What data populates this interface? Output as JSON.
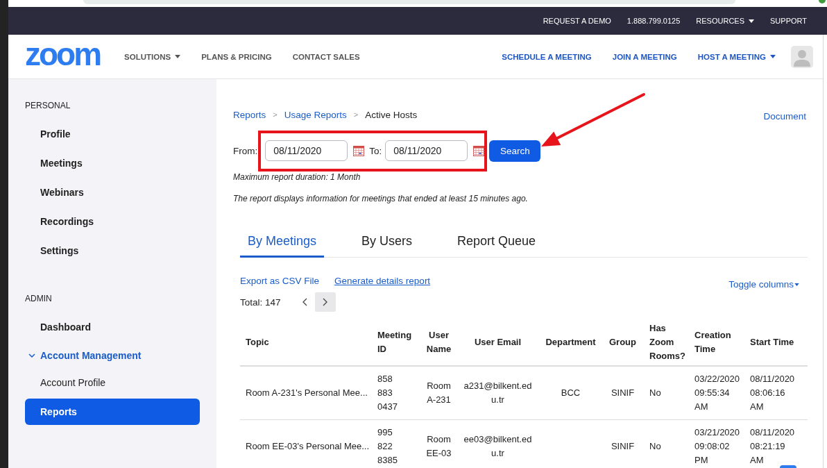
{
  "top_bar": {
    "links": [
      {
        "label": "REQUEST A DEMO",
        "dropdown": false
      },
      {
        "label": "1.888.799.0125",
        "dropdown": false
      },
      {
        "label": "RESOURCES",
        "dropdown": true
      },
      {
        "label": "SUPPORT",
        "dropdown": false
      }
    ]
  },
  "nav": {
    "logo": "zoom",
    "left_links": [
      {
        "label": "SOLUTIONS",
        "dropdown": true
      },
      {
        "label": "PLANS & PRICING",
        "dropdown": false
      },
      {
        "label": "CONTACT SALES",
        "dropdown": false
      }
    ],
    "right_links": [
      {
        "label": "SCHEDULE A MEETING",
        "dropdown": false
      },
      {
        "label": "JOIN A MEETING",
        "dropdown": false
      },
      {
        "label": "HOST A MEETING",
        "dropdown": true
      }
    ]
  },
  "sidebar": {
    "sections": [
      {
        "title": "PERSONAL",
        "items": [
          {
            "label": "Profile",
            "selected": false
          },
          {
            "label": "Meetings",
            "selected": false
          },
          {
            "label": "Webinars",
            "selected": false
          },
          {
            "label": "Recordings",
            "selected": false
          },
          {
            "label": "Settings",
            "selected": false
          }
        ]
      },
      {
        "title": "ADMIN",
        "items": [
          {
            "label": "Dashboard",
            "selected": false
          },
          {
            "label": "Account Management",
            "selected": false,
            "expanded": true,
            "children": [
              {
                "label": "Account Profile",
                "selected": false
              },
              {
                "label": "Reports",
                "selected": true
              }
            ]
          }
        ]
      }
    ]
  },
  "breadcrumb": [
    {
      "kind": "link",
      "text": "Reports"
    },
    {
      "kind": "separator",
      "text": ">"
    },
    {
      "kind": "link",
      "text": "Usage Reports"
    },
    {
      "kind": "separator",
      "text": ">"
    },
    {
      "kind": "current",
      "text": "Active Hosts"
    }
  ],
  "document_link": "Document",
  "date_filter": {
    "from_label": "From:",
    "from_value": "08/11/2020",
    "to_label": "To:",
    "to_value": "08/11/2020",
    "search_button": "Search"
  },
  "annotations": {
    "frame": true,
    "arrow": true
  },
  "notes": [
    "Maximum report duration: 1 Month",
    "The report displays information for meetings that ended at least 15 minutes ago."
  ],
  "tabs": [
    {
      "label": "By Meetings",
      "selected": true
    },
    {
      "label": "By Users",
      "selected": false
    },
    {
      "label": "Report Queue",
      "selected": false
    }
  ],
  "actions": {
    "export_link": "Export as CSV File",
    "details_link": "Generate details report",
    "toggle_columns": "Toggle columns"
  },
  "total": "Total: 147",
  "pagination": {
    "prev": {
      "hovered": false
    },
    "next": {
      "hovered": true
    }
  },
  "table": {
    "columns": [
      "Topic",
      "Meeting ID",
      "User Name",
      "User Email",
      "Department",
      "Group",
      "Has Zoom Rooms?",
      "Creation Time",
      "Start Time"
    ],
    "rows": [
      {
        "topic": "Room A-231's Personal Mee...",
        "meeting_id": "858 883 0437",
        "user_name": "Room A-231",
        "user_email": "a231@bilkent.edu.tr",
        "department": "BCC",
        "group": "SINIF",
        "has_zoom_rooms": "No",
        "creation_time": "03/22/2020 09:55:34 AM",
        "start_time": "08/11/2020 08:06:16 AM"
      },
      {
        "topic": "Room EE-03's Personal Mee...",
        "meeting_id": "995 822 8385",
        "user_name": "Room EE-03",
        "user_email": "ee03@bilkent.edu.tr",
        "group": "SINIF",
        "has_zoom_rooms": "No",
        "creation_time": "03/21/2020 09:08:02 PM",
        "start_time": "08/11/2020 08:21:19 AM"
      }
    ]
  }
}
